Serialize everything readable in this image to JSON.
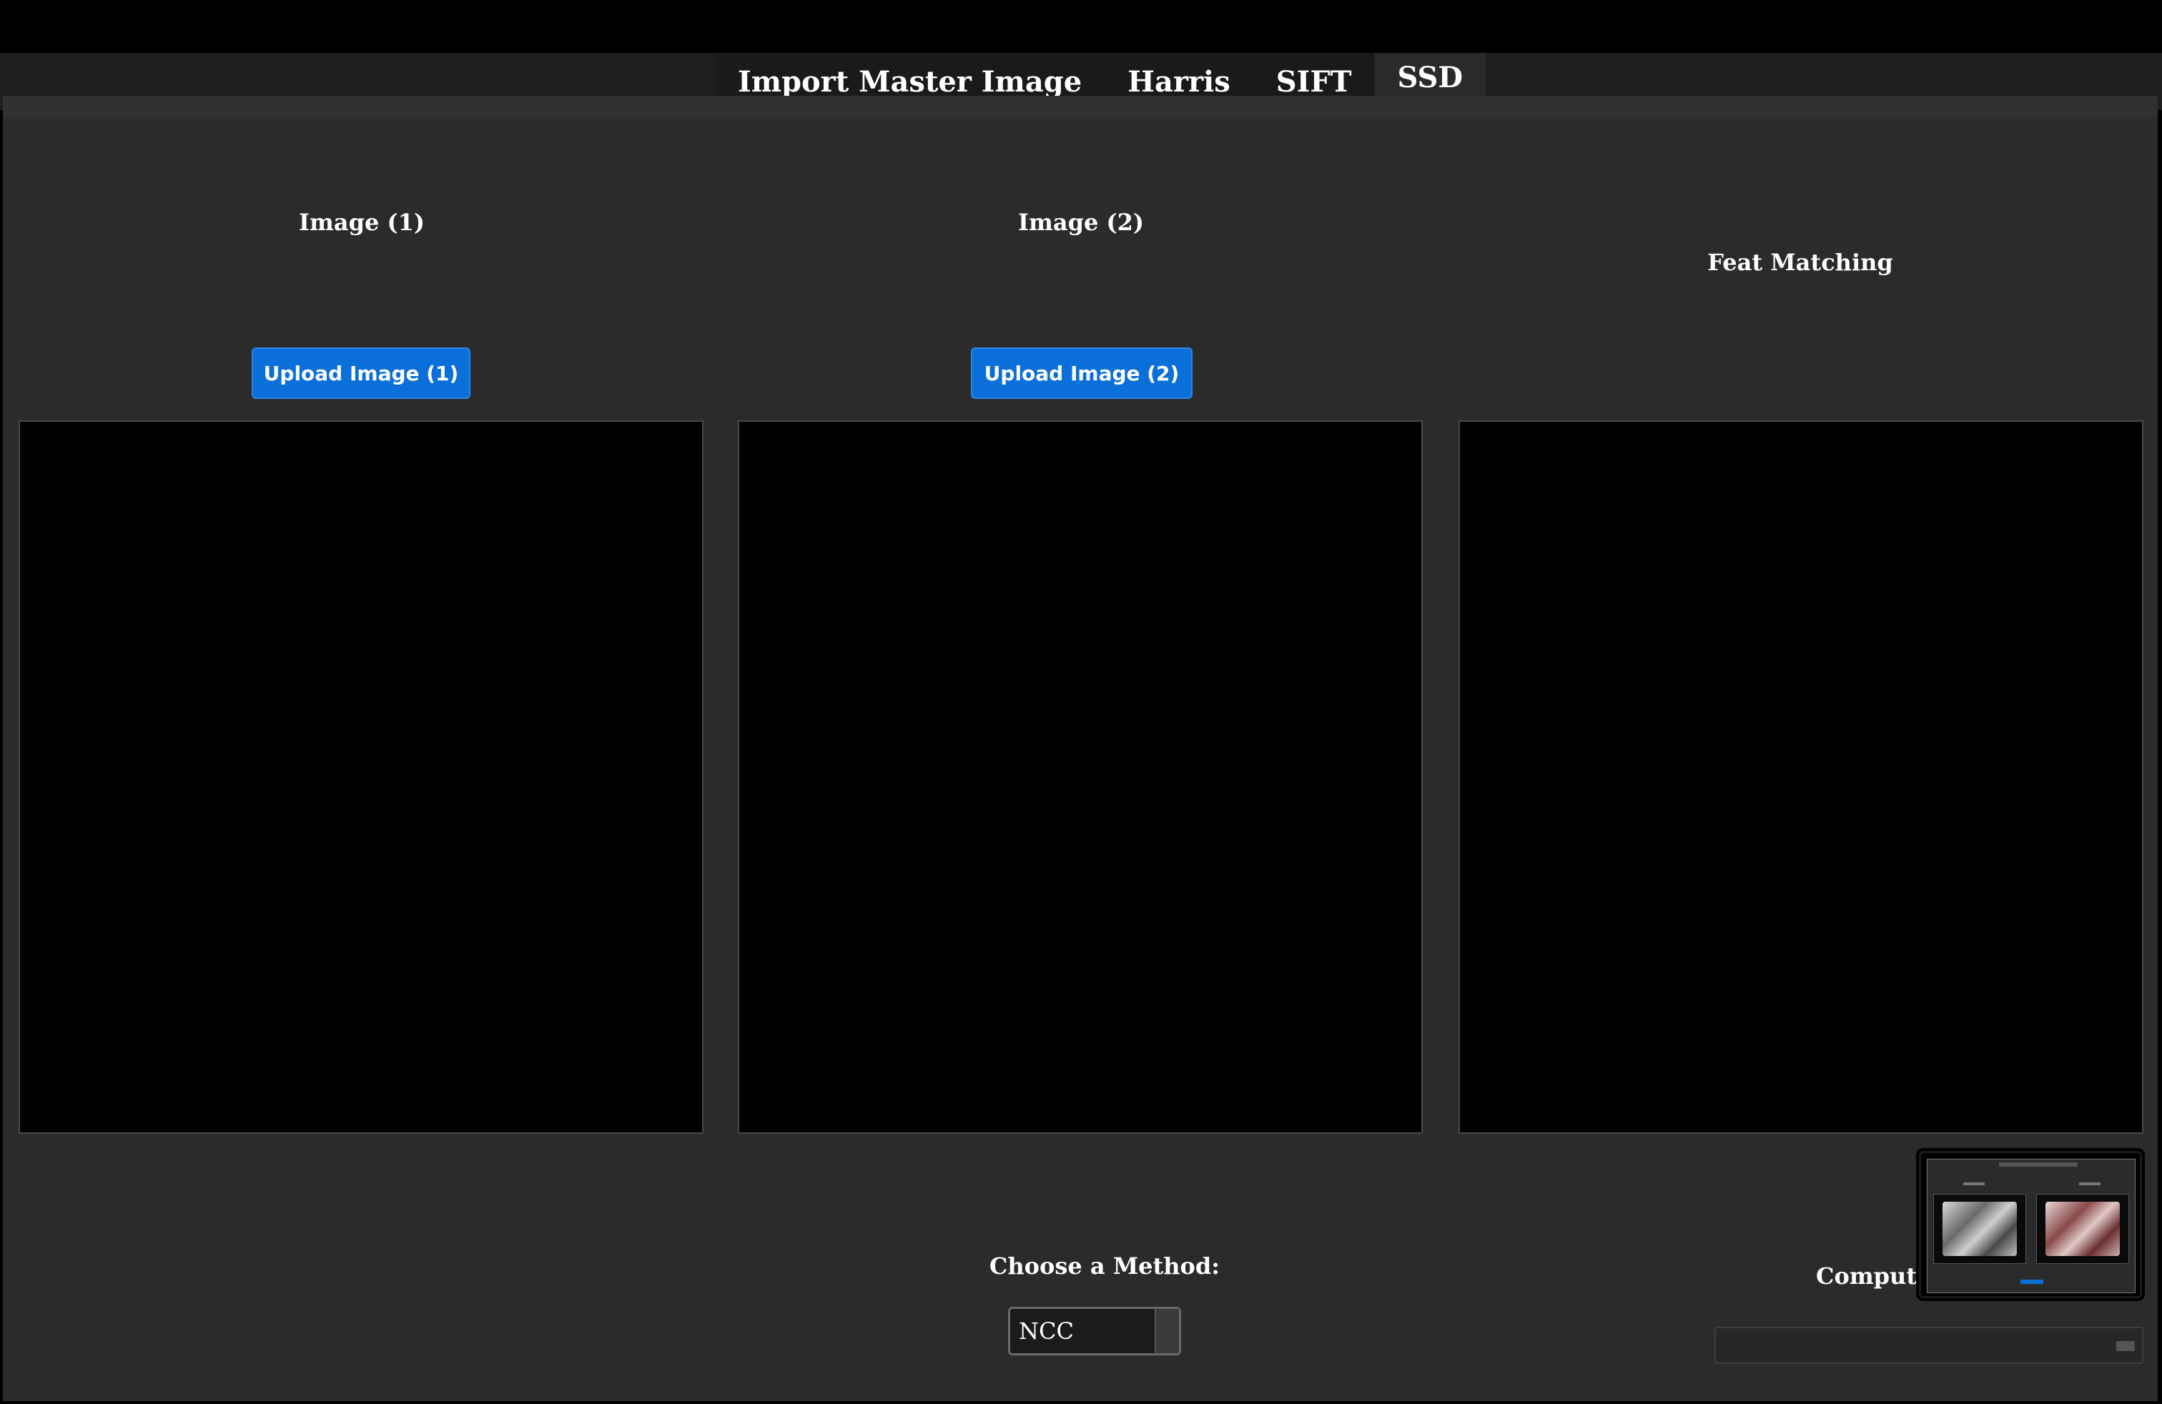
{
  "tabs": [
    {
      "label": "Import Master Image",
      "active": false
    },
    {
      "label": "Harris",
      "active": false
    },
    {
      "label": "SIFT",
      "active": false
    },
    {
      "label": "SSD",
      "active": true
    }
  ],
  "columns": {
    "image1": {
      "title": "Image (1)",
      "upload_label": "Upload Image (1)"
    },
    "image2": {
      "title": "Image (2)",
      "upload_label": "Upload Image (2)"
    },
    "matching": {
      "title": "Feat Matching"
    }
  },
  "method": {
    "label": "Choose a Method:",
    "selected": "NCC"
  },
  "compute": {
    "label_visible": "Comput"
  },
  "colors": {
    "accent": "#0a6fd9",
    "panel": "#2b2b2b",
    "background": "#000000"
  }
}
